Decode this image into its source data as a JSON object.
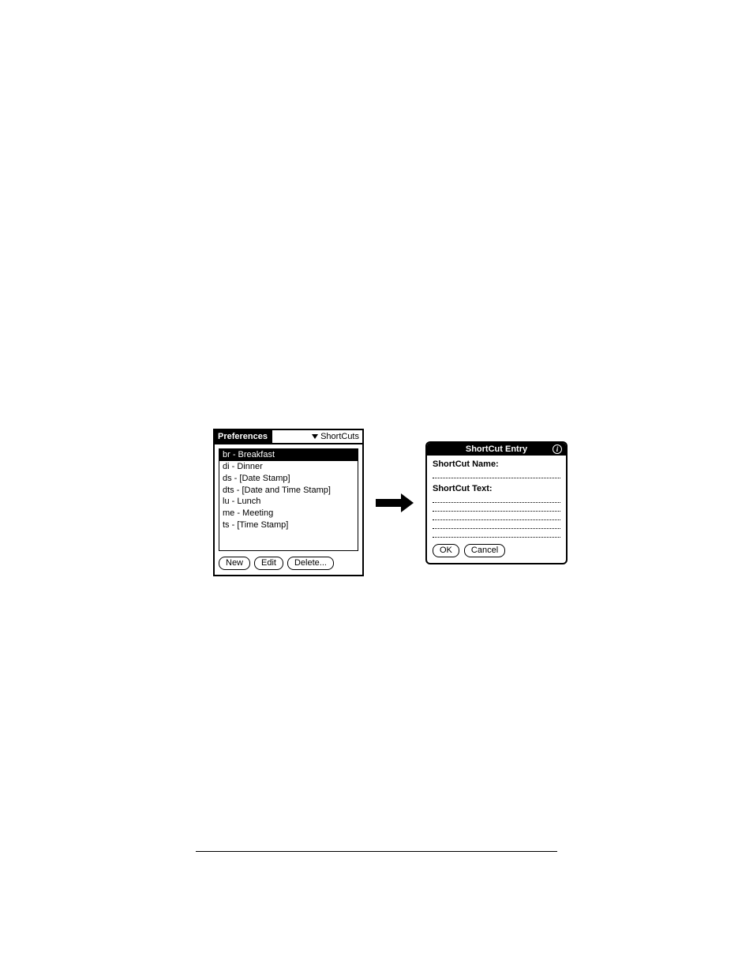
{
  "prefs": {
    "title": "Preferences",
    "menu_label": "ShortCuts",
    "items": [
      "br - Breakfast",
      "di - Dinner",
      "ds - [Date Stamp]",
      "dts - [Date and Time Stamp]",
      "lu - Lunch",
      "me - Meeting",
      "ts - [Time Stamp]"
    ],
    "buttons": {
      "new": "New",
      "edit": "Edit",
      "delete": "Delete..."
    }
  },
  "entry": {
    "title": "ShortCut Entry",
    "name_label": "ShortCut Name:",
    "text_label": "ShortCut Text:",
    "buttons": {
      "ok": "OK",
      "cancel": "Cancel"
    }
  }
}
